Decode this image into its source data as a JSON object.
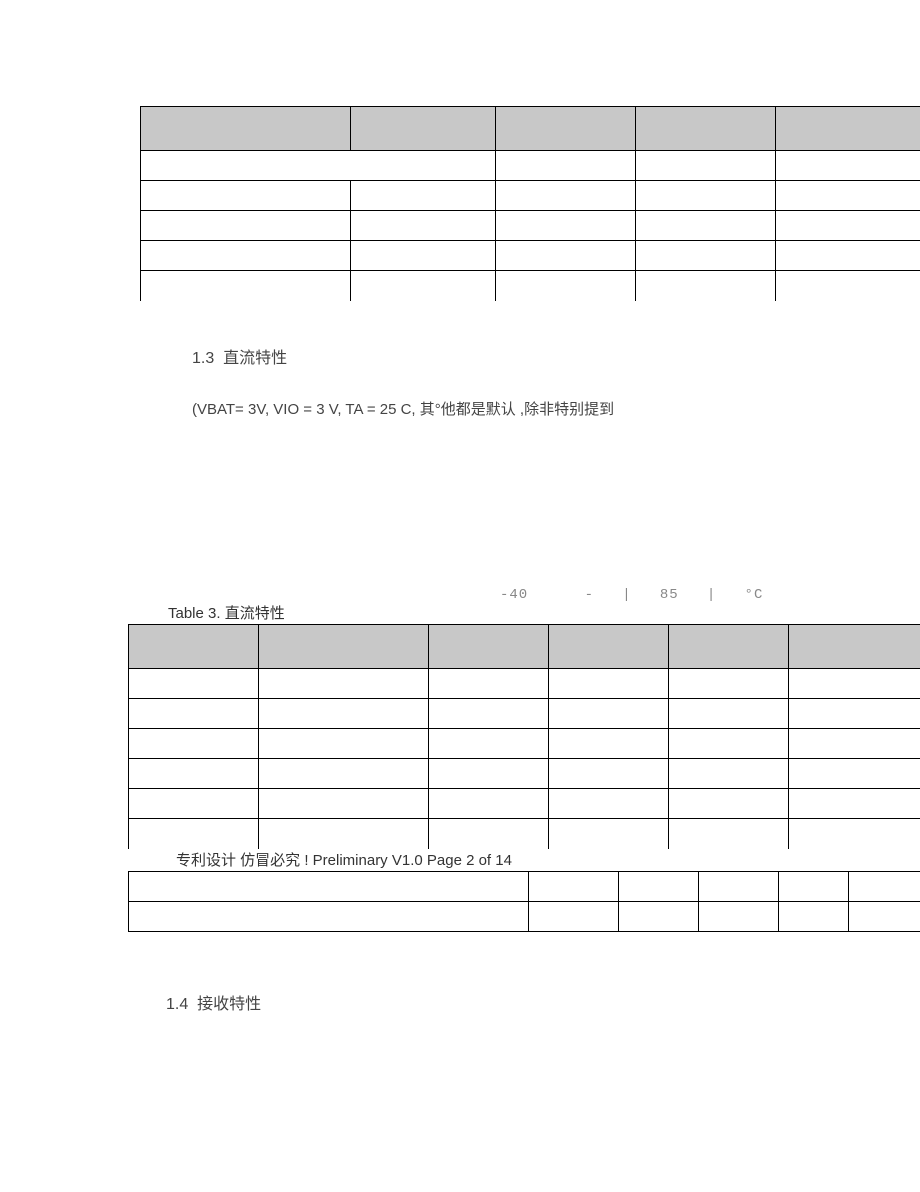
{
  "section_1_3": {
    "number": "1.3",
    "title": "直流特性",
    "condition": "(VBAT= 3V, VIO = 3 V, TA = 25 C, 其°他都是默认 ,除非特别提到"
  },
  "faint_row": {
    "v1": "-40",
    "v2": "-",
    "sep1": "|",
    "v3": "85",
    "sep2": "|",
    "v4": "°C"
  },
  "table3_caption": "Table 3. 直流特性",
  "preliminary": "专利设计 仿冒必究 ! Preliminary V1.0 Page 2 of 14",
  "section_1_4": {
    "number": "1.4",
    "title": "接收特性"
  }
}
